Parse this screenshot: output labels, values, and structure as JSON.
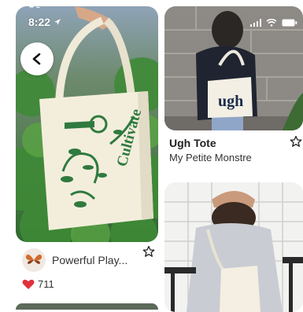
{
  "status": {
    "top": "■ 2",
    "time": "8:22"
  },
  "pins": [
    {
      "name": "Powerful Play...",
      "likes": "711"
    },
    {
      "title": "Ugh Tote",
      "subtitle": "My Petite Monstre"
    }
  ],
  "bag_text": {
    "left": "Cultivate",
    "tote": "ugh"
  },
  "colors": {
    "accent": "#2f7a3f",
    "like": "#e0303a"
  }
}
